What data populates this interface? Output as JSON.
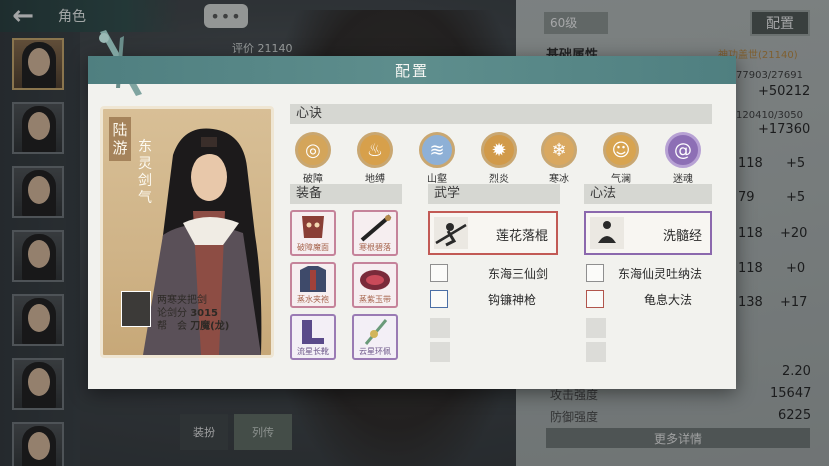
{
  "top_bar": {
    "back_icon": "back-arrow-icon",
    "title": "角色"
  },
  "chat_bubble": "•••",
  "bg_score": "评价 21140",
  "level": "60级",
  "config_button": "配置",
  "base_attr": {
    "label": "基础属性",
    "tag": "神功盖世(21140)"
  },
  "right_stats": [
    {
      "small": "77903/27691",
      "value": "+50212"
    },
    {
      "small": "120410/3050",
      "value": "+17360"
    },
    {
      "left": "118",
      "value": "+5"
    },
    {
      "left": "79",
      "value": "+5"
    },
    {
      "left": "118",
      "value": "+20"
    },
    {
      "left": "118",
      "value": "+0"
    },
    {
      "left": "138",
      "value": "+17"
    }
  ],
  "bottom_stats": [
    {
      "label": "",
      "value": "2.20"
    },
    {
      "label": "攻击强度",
      "value": "15647"
    },
    {
      "label": "防御强度",
      "value": "6225"
    }
  ],
  "more_details": "更多详情",
  "bottom_tabs": {
    "gear": "装扮",
    "bio": "列传"
  },
  "modal": {
    "title": "配置",
    "character": {
      "name": "陆游",
      "title": "东灵剑气",
      "line1": "两寒夹把剑",
      "line2_label": "论剑分",
      "line2_value": "3015",
      "line3_label": "帮　会",
      "line3_value": "刀魔(龙)"
    },
    "sections": {
      "mind": "心诀",
      "equip": "装备",
      "martial": "武学",
      "method": "心法"
    },
    "mind_skills": [
      {
        "label": "破障",
        "icon": "swirl-icon",
        "color": "#d4a55a"
      },
      {
        "label": "地缚",
        "icon": "flame-icon",
        "color": "#d7a04b"
      },
      {
        "label": "山壑",
        "icon": "wave-icon",
        "color": "#8eb0d6"
      },
      {
        "label": "烈炎",
        "icon": "fire-icon",
        "color": "#d19a4a"
      },
      {
        "label": "寒冰",
        "icon": "snowflake-icon",
        "color": "#d9a860"
      },
      {
        "label": "气澜",
        "icon": "figure-icon",
        "color": "#d8a450"
      },
      {
        "label": "迷魂",
        "icon": "spiral-icon",
        "color": "#8d6fb5"
      }
    ],
    "equipment": [
      {
        "label": "破障魔面",
        "kind": "mask-icon",
        "tone": "red"
      },
      {
        "label": "寒根碧落",
        "kind": "staff-icon",
        "tone": "red"
      },
      {
        "label": "蒸水夹袍",
        "kind": "robe-icon",
        "tone": "red"
      },
      {
        "label": "蒸紫玉带",
        "kind": "belt-icon",
        "tone": "red"
      },
      {
        "label": "流星长靴",
        "kind": "boots-icon",
        "tone": "purple"
      },
      {
        "label": "云星环佩",
        "kind": "pendant-icon",
        "tone": "purple"
      }
    ],
    "martial_main": "莲花落棍",
    "martial_list": [
      "东海三仙剑",
      "钩镰神枪"
    ],
    "method_main": "洗髓经",
    "method_list": [
      "东海仙灵吐纳法",
      "龟息大法"
    ]
  }
}
